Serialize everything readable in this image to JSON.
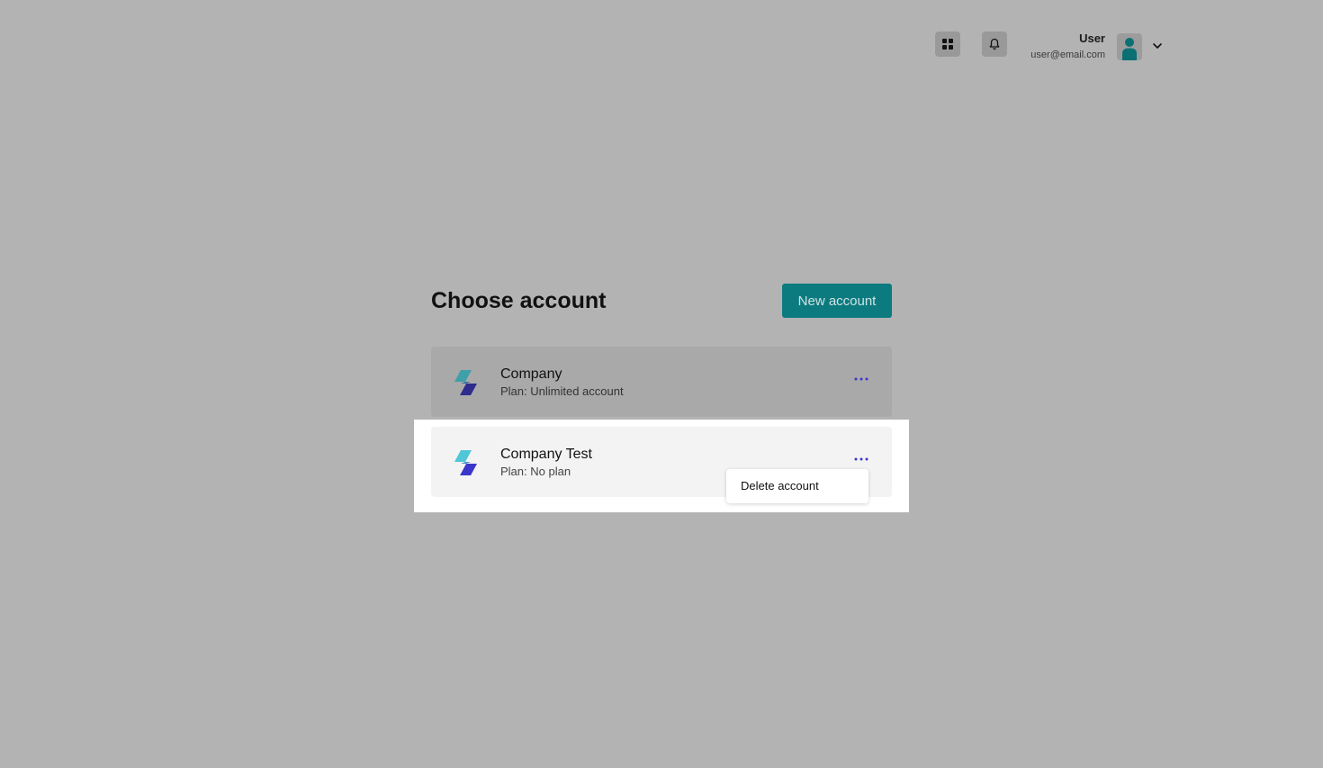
{
  "header": {
    "user_name": "User",
    "user_email": "user@email.com",
    "icons": [
      "apps-grid-icon",
      "bell-icon",
      "user-avatar-icon",
      "chevron-down-icon"
    ]
  },
  "main": {
    "title": "Choose account",
    "new_account_label": "New account",
    "accounts": [
      {
        "name": "Company",
        "plan": "Plan: Unlimited account"
      },
      {
        "name": "Company Test",
        "plan": "Plan: No plan"
      }
    ],
    "menu": {
      "delete_label": "Delete account"
    }
  },
  "colors": {
    "accent": "#0c7b80",
    "more_dots": "#3b36c9",
    "logo_teal": "#4fc7d6",
    "logo_indigo": "#3b36c9",
    "backdrop": "#b3b3b3"
  }
}
